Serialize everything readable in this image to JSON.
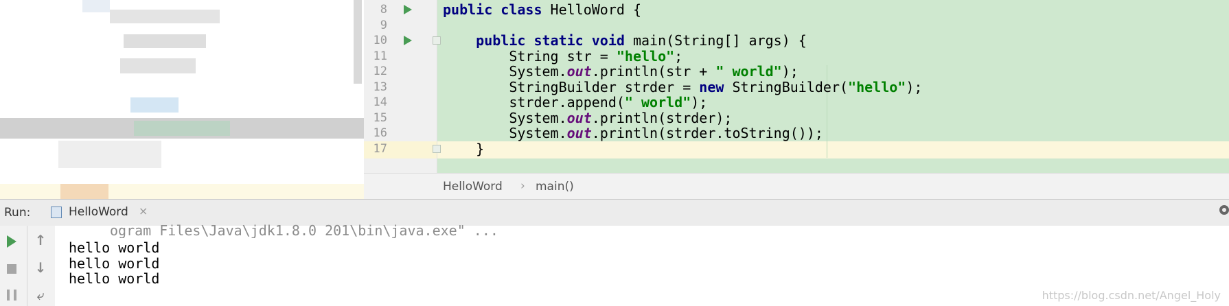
{
  "editor": {
    "lines": [
      {
        "no": "8",
        "segments": [
          {
            "t": "public class ",
            "c": "kw"
          },
          {
            "t": "HelloWord {",
            "c": ""
          }
        ]
      },
      {
        "no": "9",
        "segments": []
      },
      {
        "no": "10",
        "segments": [
          {
            "t": "    ",
            "c": ""
          },
          {
            "t": "public static void ",
            "c": "kw"
          },
          {
            "t": "main(String[] args) {",
            "c": ""
          }
        ]
      },
      {
        "no": "11",
        "segments": [
          {
            "t": "        String str = ",
            "c": ""
          },
          {
            "t": "\"hello\"",
            "c": "str"
          },
          {
            "t": ";",
            "c": ""
          }
        ]
      },
      {
        "no": "12",
        "segments": [
          {
            "t": "        System.",
            "c": ""
          },
          {
            "t": "out",
            "c": "fld"
          },
          {
            "t": ".println(str + ",
            "c": ""
          },
          {
            "t": "\" world\"",
            "c": "str"
          },
          {
            "t": ");",
            "c": ""
          }
        ]
      },
      {
        "no": "13",
        "segments": [
          {
            "t": "        StringBuilder strder = ",
            "c": ""
          },
          {
            "t": "new ",
            "c": "kw"
          },
          {
            "t": "StringBuilder(",
            "c": ""
          },
          {
            "t": "\"hello\"",
            "c": "str"
          },
          {
            "t": ");",
            "c": ""
          }
        ]
      },
      {
        "no": "14",
        "segments": [
          {
            "t": "        strder.append(",
            "c": ""
          },
          {
            "t": "\" world\"",
            "c": "str"
          },
          {
            "t": ");",
            "c": ""
          }
        ]
      },
      {
        "no": "15",
        "segments": [
          {
            "t": "        System.",
            "c": ""
          },
          {
            "t": "out",
            "c": "fld"
          },
          {
            "t": ".println(strder);",
            "c": ""
          }
        ]
      },
      {
        "no": "16",
        "segments": [
          {
            "t": "        System.",
            "c": ""
          },
          {
            "t": "out",
            "c": "fld"
          },
          {
            "t": ".println(strder.toString());",
            "c": ""
          }
        ]
      },
      {
        "no": "17",
        "segments": [
          {
            "t": "    }",
            "c": ""
          }
        ]
      }
    ],
    "run_marker_lines": [
      "8",
      "10"
    ],
    "current_line": "16"
  },
  "breadcrumb": {
    "class_name": "HelloWord",
    "separator": "›",
    "method": "main()"
  },
  "run_panel": {
    "label": "Run:",
    "tab_label": "HelloWord",
    "tab_close": "×",
    "command_fragment": "ogram Files\\Java\\jdk1.8.0_201\\bin\\java.exe\" ...",
    "output": [
      "hello world",
      "hello world",
      "hello world"
    ]
  },
  "toolbar": {
    "rerun_icon": "play-icon",
    "stop_icon": "stop-icon",
    "pause_icon": "pause-icon",
    "up_arrow": "↑",
    "down_arrow": "↓",
    "wrap_glyph": "⤶"
  },
  "watermark": "https://blog.csdn.net/Angel_Holy",
  "colors": {
    "editor_bg": "#cfe8cf",
    "keyword": "#000080",
    "string": "#008000",
    "field": "#660e7a",
    "current_line": "#fcf7dc",
    "run_green": "#499c54"
  }
}
